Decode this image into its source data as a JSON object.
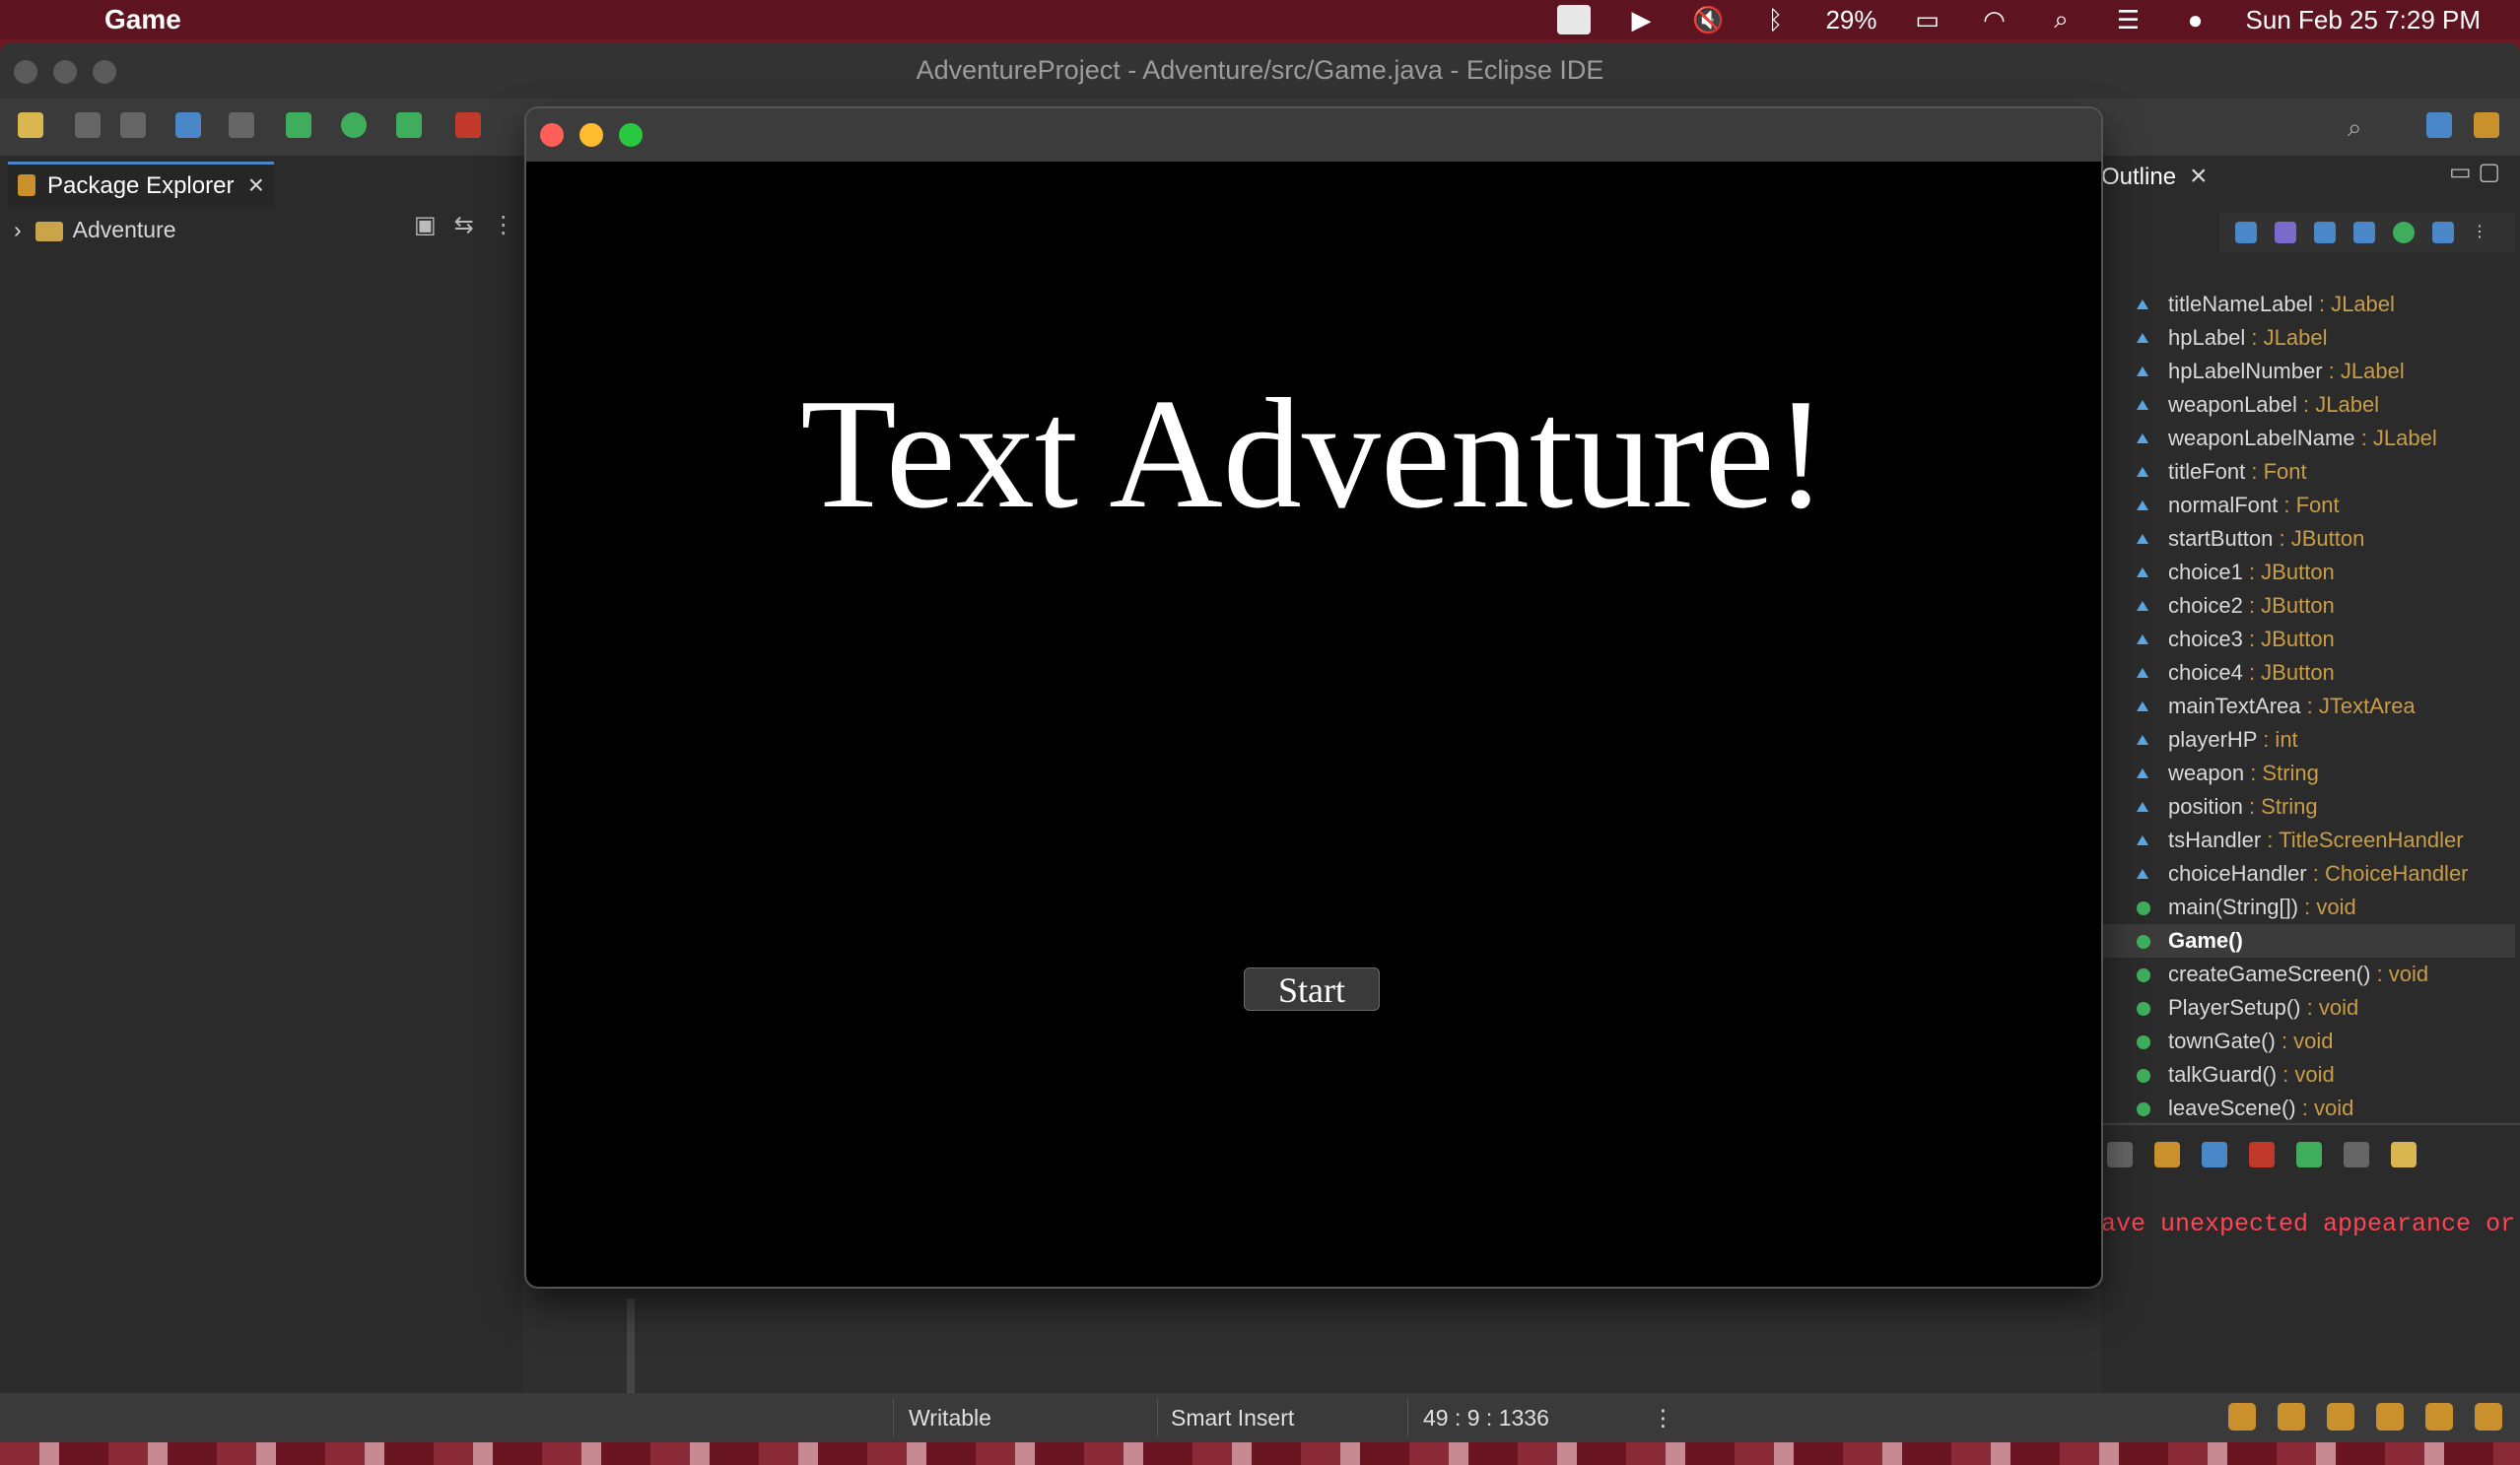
{
  "menubar": {
    "app_name": "Game",
    "battery": "29%",
    "datetime": "Sun Feb 25  7:29 PM"
  },
  "eclipse": {
    "title": "AdventureProject - Adventure/src/Game.java - Eclipse IDE",
    "package_explorer": {
      "tab_label": "Package Explorer",
      "tree": [
        {
          "label": "Adventure"
        }
      ]
    },
    "outline": {
      "tab_label": "Outline",
      "items": [
        {
          "name": "titleNameLabel",
          "type": " : JLabel",
          "kind": "field"
        },
        {
          "name": "hpLabel",
          "type": " : JLabel",
          "kind": "field"
        },
        {
          "name": "hpLabelNumber",
          "type": " : JLabel",
          "kind": "field"
        },
        {
          "name": "weaponLabel",
          "type": " : JLabel",
          "kind": "field"
        },
        {
          "name": "weaponLabelName",
          "type": " : JLabel",
          "kind": "field"
        },
        {
          "name": "titleFont",
          "type": " : Font",
          "kind": "field"
        },
        {
          "name": "normalFont",
          "type": " : Font",
          "kind": "field"
        },
        {
          "name": "startButton",
          "type": " : JButton",
          "kind": "field"
        },
        {
          "name": "choice1",
          "type": " : JButton",
          "kind": "field"
        },
        {
          "name": "choice2",
          "type": " : JButton",
          "kind": "field"
        },
        {
          "name": "choice3",
          "type": " : JButton",
          "kind": "field"
        },
        {
          "name": "choice4",
          "type": " : JButton",
          "kind": "field"
        },
        {
          "name": "mainTextArea",
          "type": " : JTextArea",
          "kind": "field"
        },
        {
          "name": "playerHP",
          "type": " : int",
          "kind": "field"
        },
        {
          "name": "weapon",
          "type": " : String",
          "kind": "field"
        },
        {
          "name": "position",
          "type": " : String",
          "kind": "field"
        },
        {
          "name": "tsHandler",
          "type": " : TitleScreenHandler",
          "kind": "field"
        },
        {
          "name": "choiceHandler",
          "type": " : ChoiceHandler",
          "kind": "field"
        },
        {
          "name": "main(String[])",
          "type": " : void",
          "kind": "method"
        },
        {
          "name": "Game()",
          "type": "",
          "kind": "method",
          "selected": true
        },
        {
          "name": "createGameScreen()",
          "type": " : void",
          "kind": "method"
        },
        {
          "name": "PlayerSetup()",
          "type": " : void",
          "kind": "method"
        },
        {
          "name": "townGate()",
          "type": " : void",
          "kind": "method"
        },
        {
          "name": "talkGuard()",
          "type": " : void",
          "kind": "method"
        },
        {
          "name": "leaveScene()",
          "type": " : void",
          "kind": "method"
        }
      ]
    },
    "console_message": "ave unexpected appearance or",
    "status": {
      "writable": "Writable",
      "insert_mode": "Smart Insert",
      "position": "49 : 9 : 1336"
    }
  },
  "game_window": {
    "title_text": "Text Adventure!",
    "start_label": "Start",
    "colors": {
      "background": "#000000",
      "text": "#ffffff",
      "button": "#3a3a3a"
    }
  },
  "icons": [
    "apple-icon",
    "video-icon",
    "play-icon",
    "mute-icon",
    "bluetooth-icon",
    "battery-icon",
    "wifi-icon",
    "search-icon",
    "control-center-icon",
    "siri-icon"
  ]
}
